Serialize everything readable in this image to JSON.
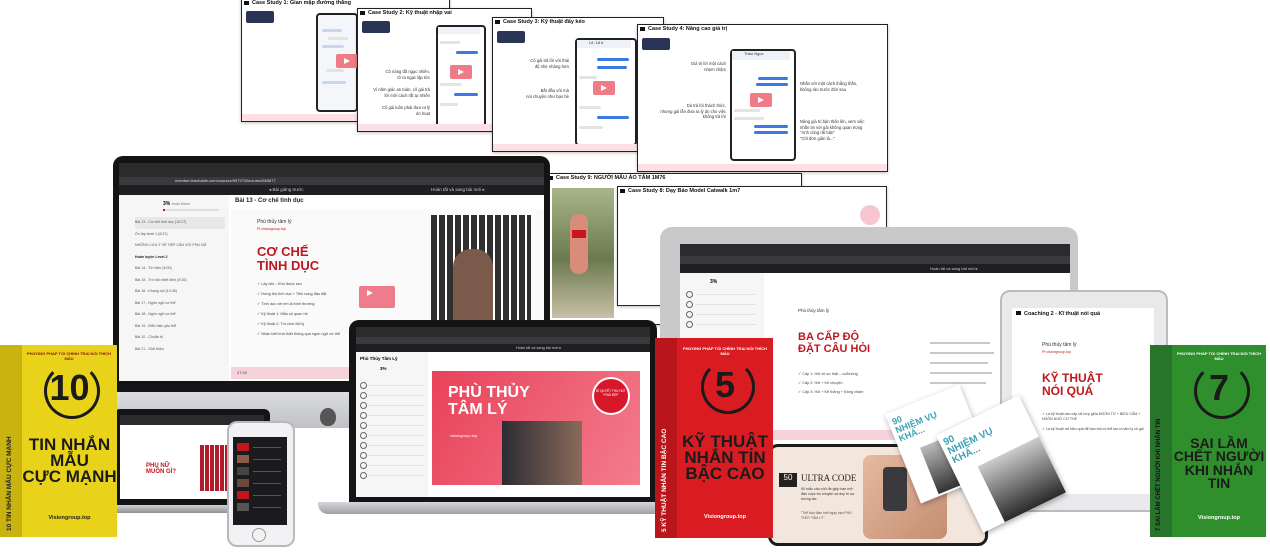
{
  "case_studies": [
    {
      "title": "Case Study 1: Gian mập đường thẳng"
    },
    {
      "title": "Case Study 2: Kỹ thuật nhập vai",
      "lines": [
        "Cô nàng đã ngạc nhiên,",
        "tỏ ra ngạc lập tức",
        "Vì năm giác an toàn, cô gái trả",
        "lời mời cách rất tự nhiên",
        "Cô gái luôn phải đưa ra lý",
        "do hoạt"
      ]
    },
    {
      "title": "Case Study 3: Kỹ thuật đẩy kéo",
      "lines": [
        "Cô gái trả lời với thái",
        "độ nhẹ nhàng hơn",
        "Bắt đầu với mà",
        "nói chuyện như bạn bè"
      ],
      "contact": "Lê, 18 tr"
    },
    {
      "title": "Case Study 4: Nâng cao giá trị",
      "lines_left": [
        "Giá trị lời một cách",
        "nhẹm chậm",
        "Dù trả lời thách thức,",
        "nhưng gái lẫn đưa ra lý do cho việc",
        "không trả lời"
      ],
      "lines_right": [
        "Nhắn với một cách thẳng thắn,",
        "không rào trước đón sau",
        "Nâng giá trị bản thân lên, xem việc",
        "nhắn tin với gái không quan trọng",
        "\"Anh cũng rất bận\"",
        "\"Chỉ đơn giản là...\""
      ],
      "contact": "Thảo Ngọc"
    }
  ],
  "laptop_main": {
    "url": "member.teachable.com/courses/997970/lectures/869877",
    "nav_prev": "◂ Bài giảng trước",
    "nav_next": "Hoàn tất và sang bài mới ▸",
    "lesson_title": "Bài 13 - Cơ chế tình dục",
    "progress": "3%",
    "progress_label": "Hoàn thành",
    "section": "Huấn luyện Level 2",
    "sidebar_items": [
      "Bài 13 - Cơ chế tình dục (10:27)",
      "Ôn tập level 1 (8:21)",
      "NHỮNG LƯU Ý VỀ TIẾP CẬN VỚI PHỤ NỮ",
      "Huấn luyện Level 2",
      "Bài 14 - Tín hiệu (8:00)",
      "Bài 15 - Trò trải nhiệt đinh (8:35)",
      "Bài 16 - Khang nội (10:36)",
      "Bài 17 - Ngôn ngữ cơ thể",
      "Bài 18 - Ngôn ngữ cơ thể",
      "Bài 19 - Biểu hiệu yêu thể",
      "Bài 20 - Chuẩn bị",
      "Bài 21 - Giới thiệu"
    ],
    "slide_kicker": "Phù thủy tâm lý",
    "slide_brand": "Pt visiongroup.top",
    "slide_title_1": "CƠ CHẾ",
    "slide_title_2": "TÌNH DỤC",
    "bullets": [
      "Lấy dát – Khó được sex",
      "Hứng thú tình dục + Tiến nồng đậu đặt",
      "Tình dục với em là bình thường",
      "Kỹ thuật 1: Mẫu số quan hệ",
      "Kỹ thuật 2: Trò chơi đối lý",
      "Nhận biết khả thiết thông qua ngôn ngữ cơ thể"
    ],
    "time": "27:00"
  },
  "case_9": {
    "title": "Case Study 9: NGƯỜI MẪU ÁO TẮM 1M76"
  },
  "case_8": {
    "title": "Case Study 8: Dạy Bảo Model Catwalk 1m7"
  },
  "laptop_right": {
    "progress": "3%",
    "slide_kicker": "Phù thủy tâm lý",
    "slide_title_1": "BA CẤP ĐỘ",
    "slide_title_2": "ĐẶT CÂU HỎI",
    "levels": [
      "Cấp 1: Hỏi về sự thật – có/không",
      "Cấp 2: Hỏi + Kế chuyện",
      "Cấp 3: Hỏi + Kể thắng + Đồng chậm"
    ],
    "nav_next": "Hoàn tất và sang bài mới ▸"
  },
  "tablet": {
    "title": "Coaching 2 - Kĩ thuật nói quá",
    "kicker": "Phù thủy tâm lý",
    "brand": "Pt visiongroup.top",
    "slide_title_1": "KỸ THUẬT",
    "slide_title_2": "NÓI QUÁ",
    "bullets": [
      "Là kỹ thuật cao cấp rất hợp giữa NGÔN TỪ + BIỂU CẢM + NGÔN NGỮ CƠ THỂ",
      "Là kỹ thuật rất hiệu quả để bạn trai có thể tạo ra tâm lý cô gái"
    ]
  },
  "macbook": {
    "course": "Phù Thủy Tâm Lý",
    "progress": "3%",
    "banner_title_1": "PHÙ THỦY",
    "banner_title_2": "TÂM LÝ",
    "badge": "BÍ QUYẾT THU HÚT PHÁI ĐẸP",
    "brand": "visiongroup.top",
    "nav_next": "Hoàn tất và sang bài mới ▸"
  },
  "small_laptop": {
    "title_1": "PHỤ NỮ",
    "title_2": "MUỐN GÌ?"
  },
  "ultra_card": {
    "title": "ULTRA CODE",
    "number": "50",
    "text": "50 mẫu câu chủ đề giúp bạn mở đầu cuộc trò chuyện và duy trì sự tương tác",
    "footer": "\"Thể bảo đảm biết ngay bạn PHÙ THỦY TÂM LÝ\""
  },
  "mission_cards": {
    "line_1": "90",
    "line_2": "NHIỆM VỤ",
    "line_3": "KHÁ..."
  },
  "books": [
    {
      "id": "book10",
      "kicker": "PHƯƠNG PHÁP TỐI CHÍNH TRAI NÓI THÍCH MẪU",
      "number": "10",
      "title": [
        "TIN NHẮN",
        "MẪU",
        "CỰC MẠNH"
      ],
      "brand": "Visiongroup.top",
      "spine": "10 TIN NHẮN MẪU CỰC MẠNH"
    },
    {
      "id": "book5",
      "kicker": "PHƯƠNG PHÁP TỐI CHÍNH TRAI NÓI THÍCH MẪU",
      "number": "5",
      "title": [
        "KỸ THUẬT",
        "NHẮN TIN",
        "BẬC CAO"
      ],
      "brand": "Visiongroup.top",
      "spine": "5 KỸ THUẬT NHẮN TIN BẬC CAO"
    },
    {
      "id": "book7",
      "kicker": "PHƯƠNG PHÁP TỐI CHÍNH TRAI NÓI THÍCH MẪU",
      "number": "7",
      "title": [
        "SAI LẦM",
        "CHẾT NGƯỜI",
        "KHI NHẮN TIN"
      ],
      "brand": "Visiongroup.top",
      "spine": "7 SAI LẦM CHẾT NGƯỜI KHI NHẮN TIN"
    }
  ],
  "colors": {
    "accent_red": "#c0161d",
    "book_yellow": "#e8d21a",
    "book_red": "#d81c22",
    "book_green": "#2f8f2c",
    "play_pink": "#f07a86"
  }
}
